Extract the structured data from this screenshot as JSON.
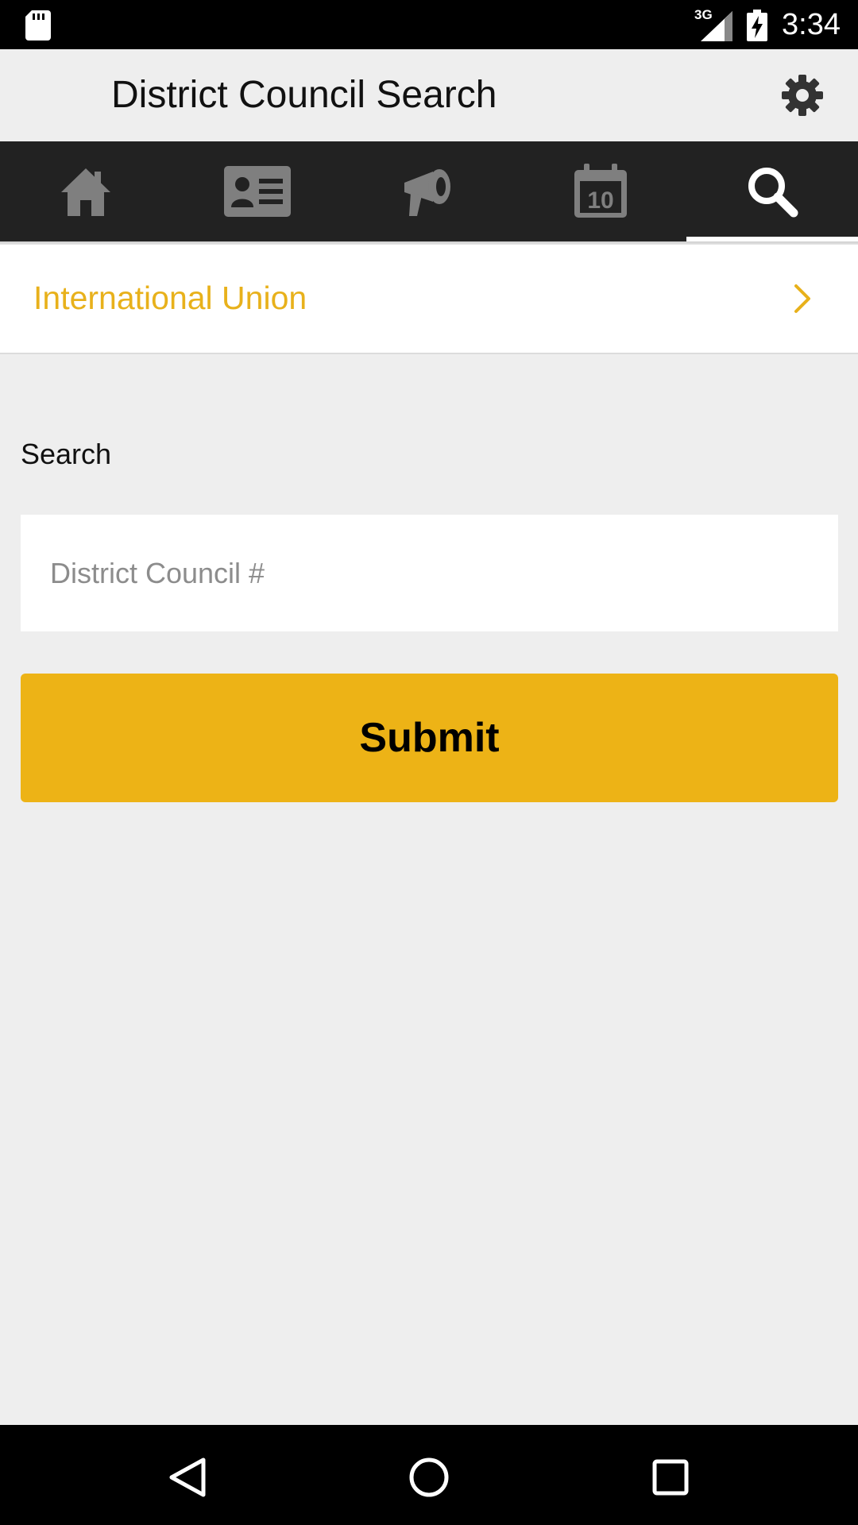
{
  "status_bar": {
    "network": "3G",
    "time": "3:34",
    "icons": [
      "sd-card-icon",
      "signal-icon",
      "battery-charging-icon"
    ]
  },
  "app_bar": {
    "title": "District Council Search",
    "settings_icon": "gear-icon"
  },
  "tabs": [
    {
      "name": "home",
      "icon": "home-icon",
      "active": false
    },
    {
      "name": "contact-card",
      "icon": "contact-card-icon",
      "active": false
    },
    {
      "name": "announcements",
      "icon": "megaphone-icon",
      "active": false
    },
    {
      "name": "calendar",
      "icon": "calendar-icon",
      "calendar_day": "10",
      "active": false
    },
    {
      "name": "search",
      "icon": "search-icon",
      "active": true
    }
  ],
  "org_row": {
    "label": "International Union",
    "icon": "chevron-right-icon"
  },
  "search": {
    "label": "Search",
    "placeholder": "District Council #",
    "value": ""
  },
  "submit": {
    "label": "Submit"
  },
  "nav_bar": {
    "buttons": [
      "back-icon",
      "home-circle-icon",
      "recents-icon"
    ]
  },
  "colors": {
    "accent": "#edb316",
    "org_text": "#e8b11b",
    "tab_bar_bg": "#222222",
    "tab_icon_inactive": "#7f7f7f",
    "tab_icon_active": "#ffffff",
    "page_bg": "#eeeeee"
  }
}
